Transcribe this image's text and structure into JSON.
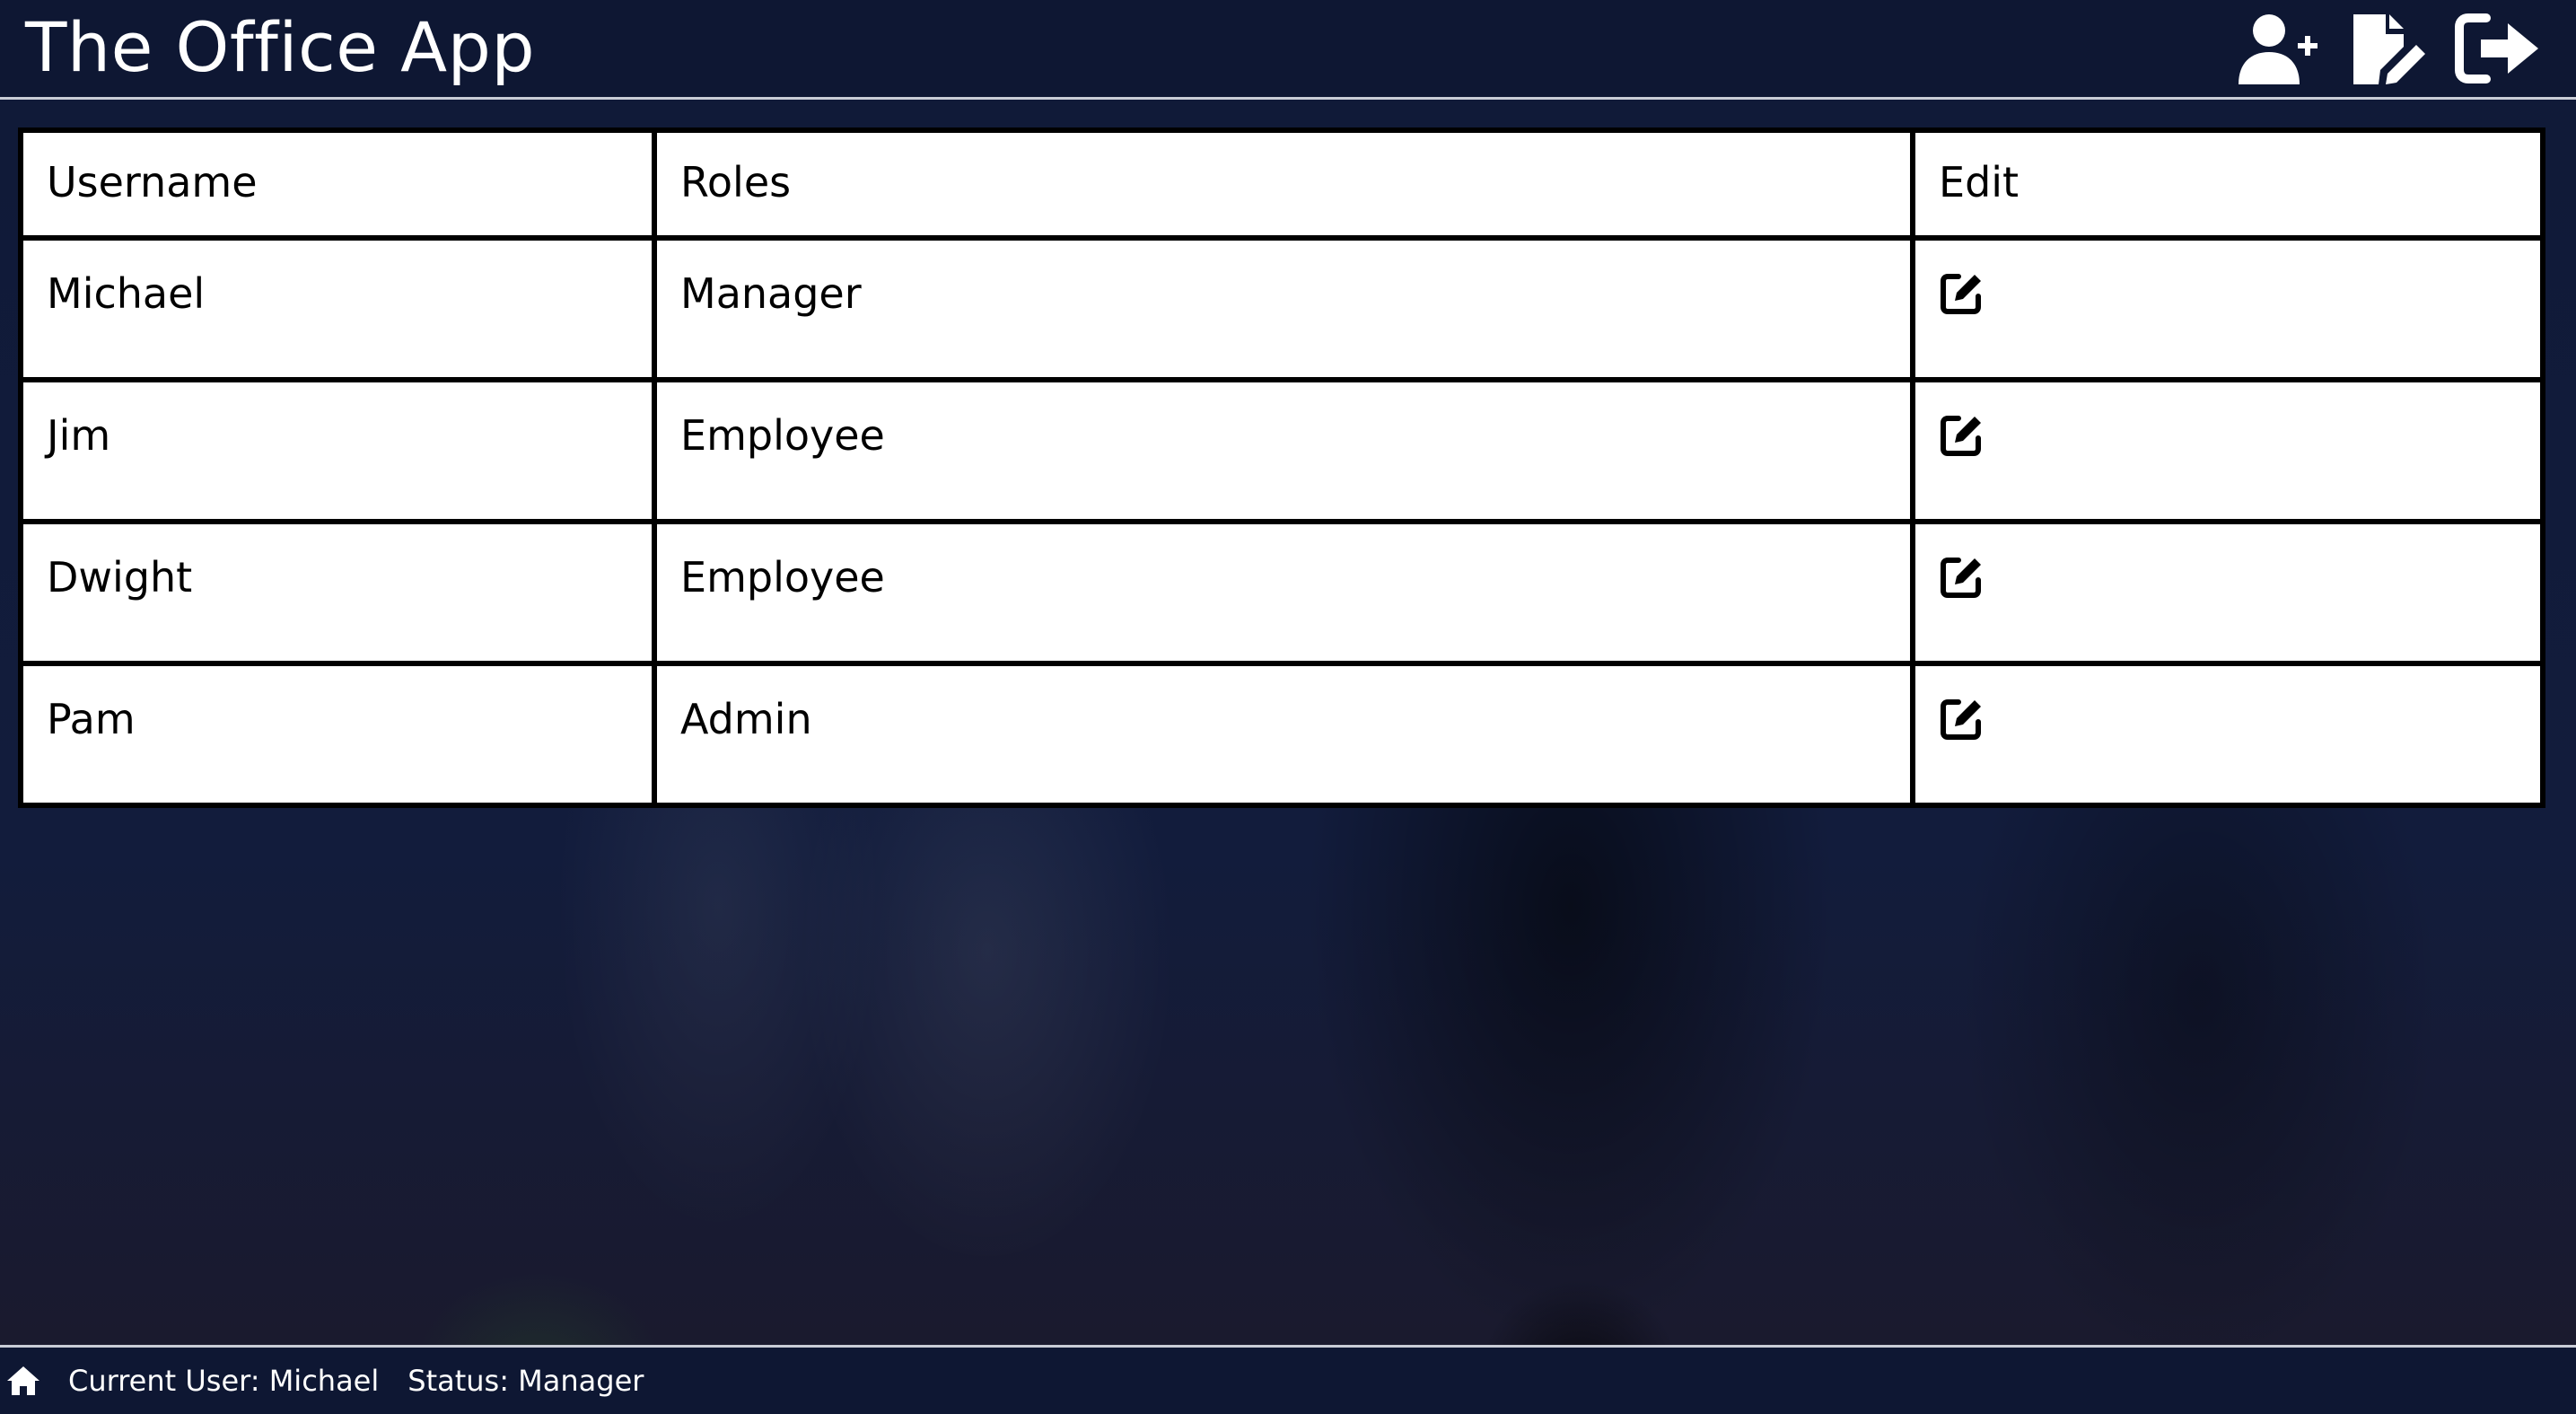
{
  "header": {
    "title": "The Office App",
    "icons": [
      "add-user-icon",
      "edit-document-icon",
      "logout-icon"
    ]
  },
  "table": {
    "columns": [
      "Username",
      "Roles",
      "Edit"
    ],
    "rows": [
      {
        "username": "Michael",
        "role": "Manager",
        "edit_icon": "edit-icon"
      },
      {
        "username": "Jim",
        "role": "Employee",
        "edit_icon": "edit-icon"
      },
      {
        "username": "Dwight",
        "role": "Employee",
        "edit_icon": "edit-icon"
      },
      {
        "username": "Pam",
        "role": "Admin",
        "edit_icon": "edit-icon"
      }
    ]
  },
  "footer": {
    "home_icon": "home-icon",
    "current_user": "Current User: Michael",
    "status": "Status: Manager"
  },
  "colors": {
    "header_bg": "#0e1733",
    "table_bg": "#ffffff",
    "grid": "#000000",
    "text_light": "#ffffff"
  }
}
